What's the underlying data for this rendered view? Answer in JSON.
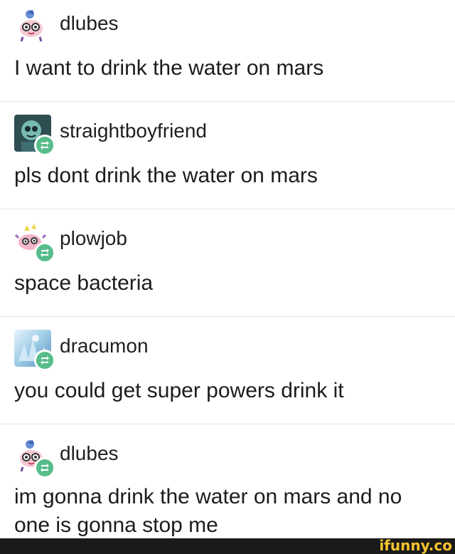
{
  "posts": [
    {
      "username": "dlubes",
      "text": "I want to drink the water on mars",
      "reblogged": false
    },
    {
      "username": "straightboyfriend",
      "text": "pls dont drink the water on mars",
      "reblogged": true
    },
    {
      "username": "plowjob",
      "text": "space bacteria",
      "reblogged": true
    },
    {
      "username": "dracumon",
      "text": "you could get super powers drink it",
      "reblogged": true
    },
    {
      "username": "dlubes",
      "text": "im gonna drink the water on mars and no one is gonna stop me",
      "reblogged": true
    }
  ],
  "watermark": "ifunny.co",
  "colors": {
    "reblog_badge": "#56bc8a",
    "watermark": "#f7c32e",
    "footer_bar": "#1a1a1a"
  }
}
